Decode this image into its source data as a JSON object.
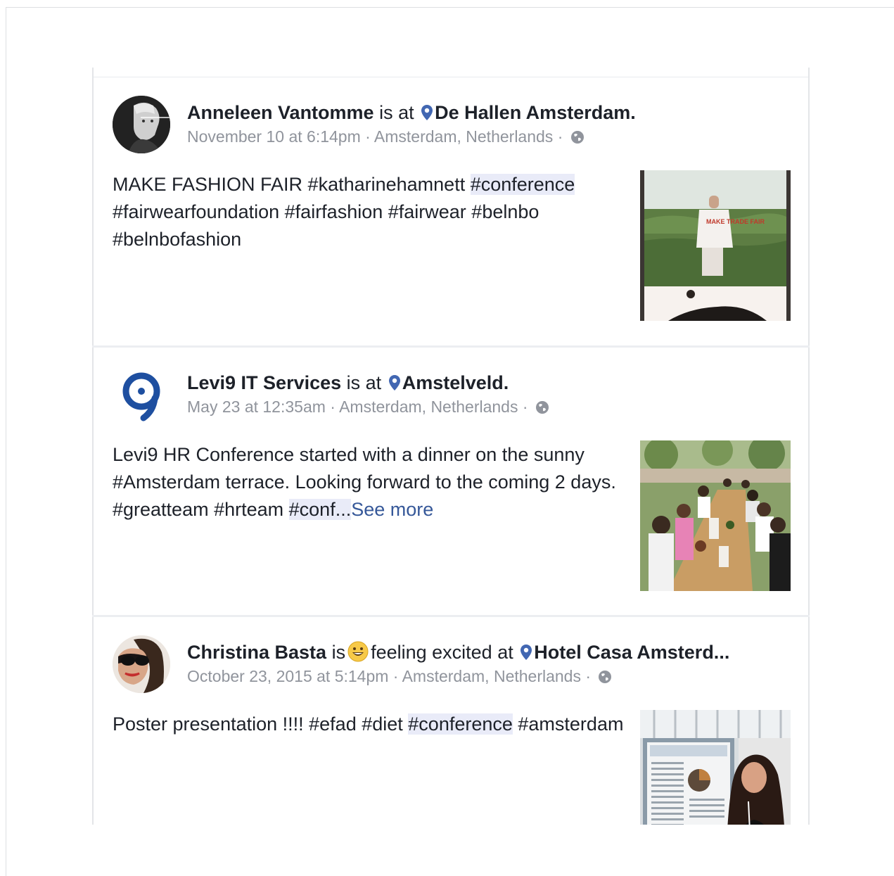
{
  "posts": [
    {
      "author": "Anneleen Vantomme",
      "connector": "is at",
      "place": "De Hallen Amsterdam.",
      "date": "November 10 at 6:14pm",
      "location": "Amsterdam, Netherlands",
      "text_before": "MAKE FASHION FAIR #katharinehamnett ",
      "text_highlight": "#conference",
      "text_after": " #fairwearfoundation #fairfashion #fairwear #belnbo #belnbofashion",
      "photo_text": "MAKE TRADE FAIR"
    },
    {
      "author": "Levi9 IT Services",
      "connector": "is at",
      "place": "Amstelveld.",
      "date": "May 23 at 12:35am",
      "location": "Amsterdam, Netherlands",
      "text_before": "Levi9 HR Conference started with a dinner on the sunny #Amsterdam terrace. Looking forward to the coming 2 days. #greatteam #hrteam ",
      "text_highlight": "#conf...",
      "see_more": "See more"
    },
    {
      "author": "Christina Basta",
      "connector": "is",
      "feeling": "feeling excited at",
      "place": "Hotel Casa Amsterd...",
      "date": "October 23, 2015 at 5:14pm",
      "location": "Amsterdam, Netherlands",
      "text_before": "Poster presentation !!!! #efad #diet ",
      "text_highlight": "#conference",
      "text_after": " #amsterdam"
    }
  ],
  "separator": " · ",
  "colors": {
    "text": "#1d2129",
    "meta": "#90949c",
    "pin": "#4267b2",
    "link": "#365899",
    "highlight_bg": "#e9ebf8"
  }
}
